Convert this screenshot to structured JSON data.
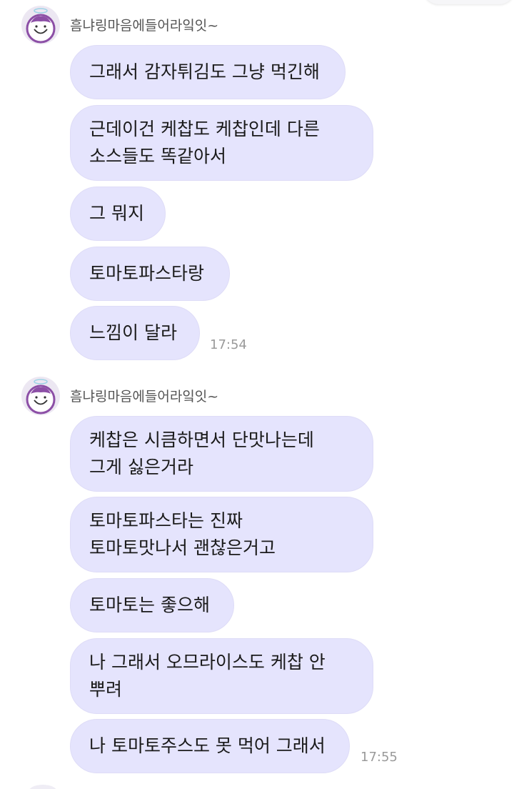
{
  "groups": [
    {
      "sender": "흠냐링마음에들어라잌잇~",
      "timestamp": "17:54",
      "messages": [
        "그래서 감자튀김도 그냥 먹긴해",
        "근데이건 케찹도 케찹인데 다른\n소스들도 똑같아서",
        "그 뭐지",
        "토마토파스타랑",
        "느낌이 달라"
      ]
    },
    {
      "sender": "흠냐링마음에들어라잌잇~",
      "timestamp": "17:55",
      "messages": [
        "케찹은 시큼하면서 단맛나는데\n그게 싫은거라",
        "토마토파스타는 진짜\n토마토맛나서 괜찮은거고",
        "토마토는 좋으해",
        "나 그래서 오므라이스도 케찹 안\n뿌려",
        "나 토마토주스도 못 먹어 그래서"
      ]
    }
  ],
  "avatar_icon": "cartoon-face-with-halo"
}
